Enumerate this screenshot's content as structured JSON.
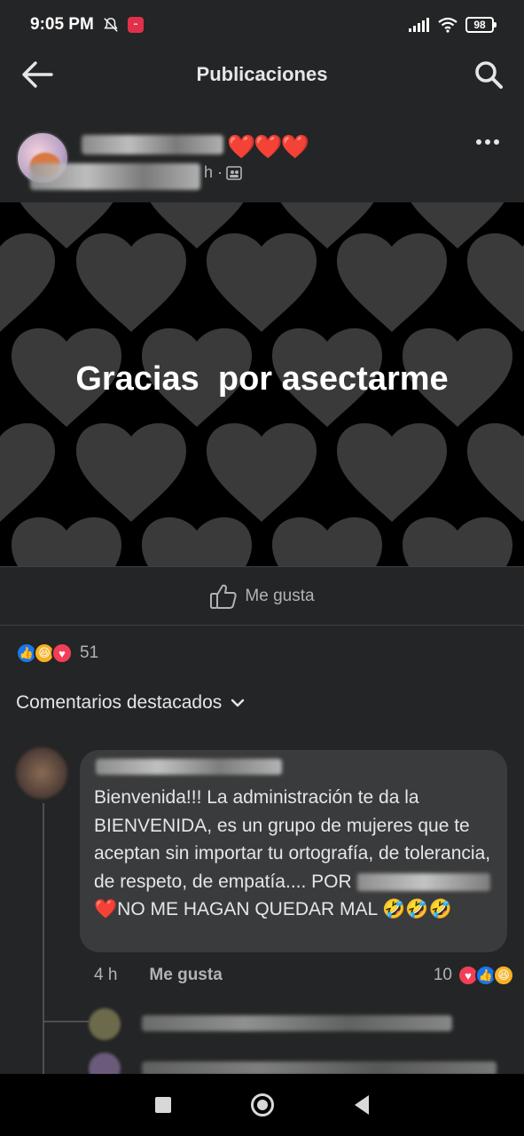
{
  "status_bar": {
    "time": "9:05 PM",
    "battery": "98",
    "icons": [
      "bell-muted-icon",
      "app-notification-icon",
      "signal-icon",
      "wifi-icon",
      "battery-icon"
    ]
  },
  "header": {
    "title": "Publicaciones",
    "back_icon": "arrow-left-icon",
    "search_icon": "search-icon"
  },
  "post": {
    "author_hearts": "❤️❤️❤️",
    "time_suffix": "h ·",
    "audience_icon": "group-icon",
    "more_icon": "more-horizontal-icon",
    "image_text": "Gracias  por asectarme",
    "image_colors": {
      "background": "#000000",
      "hearts": "#3a3a3a"
    },
    "like_label": "Me gusta",
    "reaction_count": "51",
    "reactions": [
      "like",
      "haha",
      "love"
    ]
  },
  "comments_section": {
    "label": "Comentarios destacados",
    "dropdown_icon": "chevron-down-icon"
  },
  "comment": {
    "text_before": "Bienvenida!!! La administración te da la BIENVENIDA, es un grupo de mujeres que te aceptan sin importar tu ortografía, de tolerancia, de respeto, de empatía.... POR",
    "text_after": "❤️NO ME HAGAN QUEDAR MAL 🤣🤣🤣",
    "time": "4 h",
    "like_label": "Me gusta",
    "reaction_count": "10",
    "reactions": [
      "love",
      "like",
      "haha"
    ]
  },
  "nav_bar": {
    "buttons": [
      "recents-square-icon",
      "home-circle-icon",
      "back-triangle-icon"
    ]
  },
  "colors": {
    "background": "#242526",
    "bubble": "#3a3b3c",
    "text_primary": "#e4e6eb",
    "text_secondary": "#b0b3b8",
    "like_blue": "#1877f2",
    "love_red": "#f33e58",
    "haha_yellow": "#f7b125"
  }
}
